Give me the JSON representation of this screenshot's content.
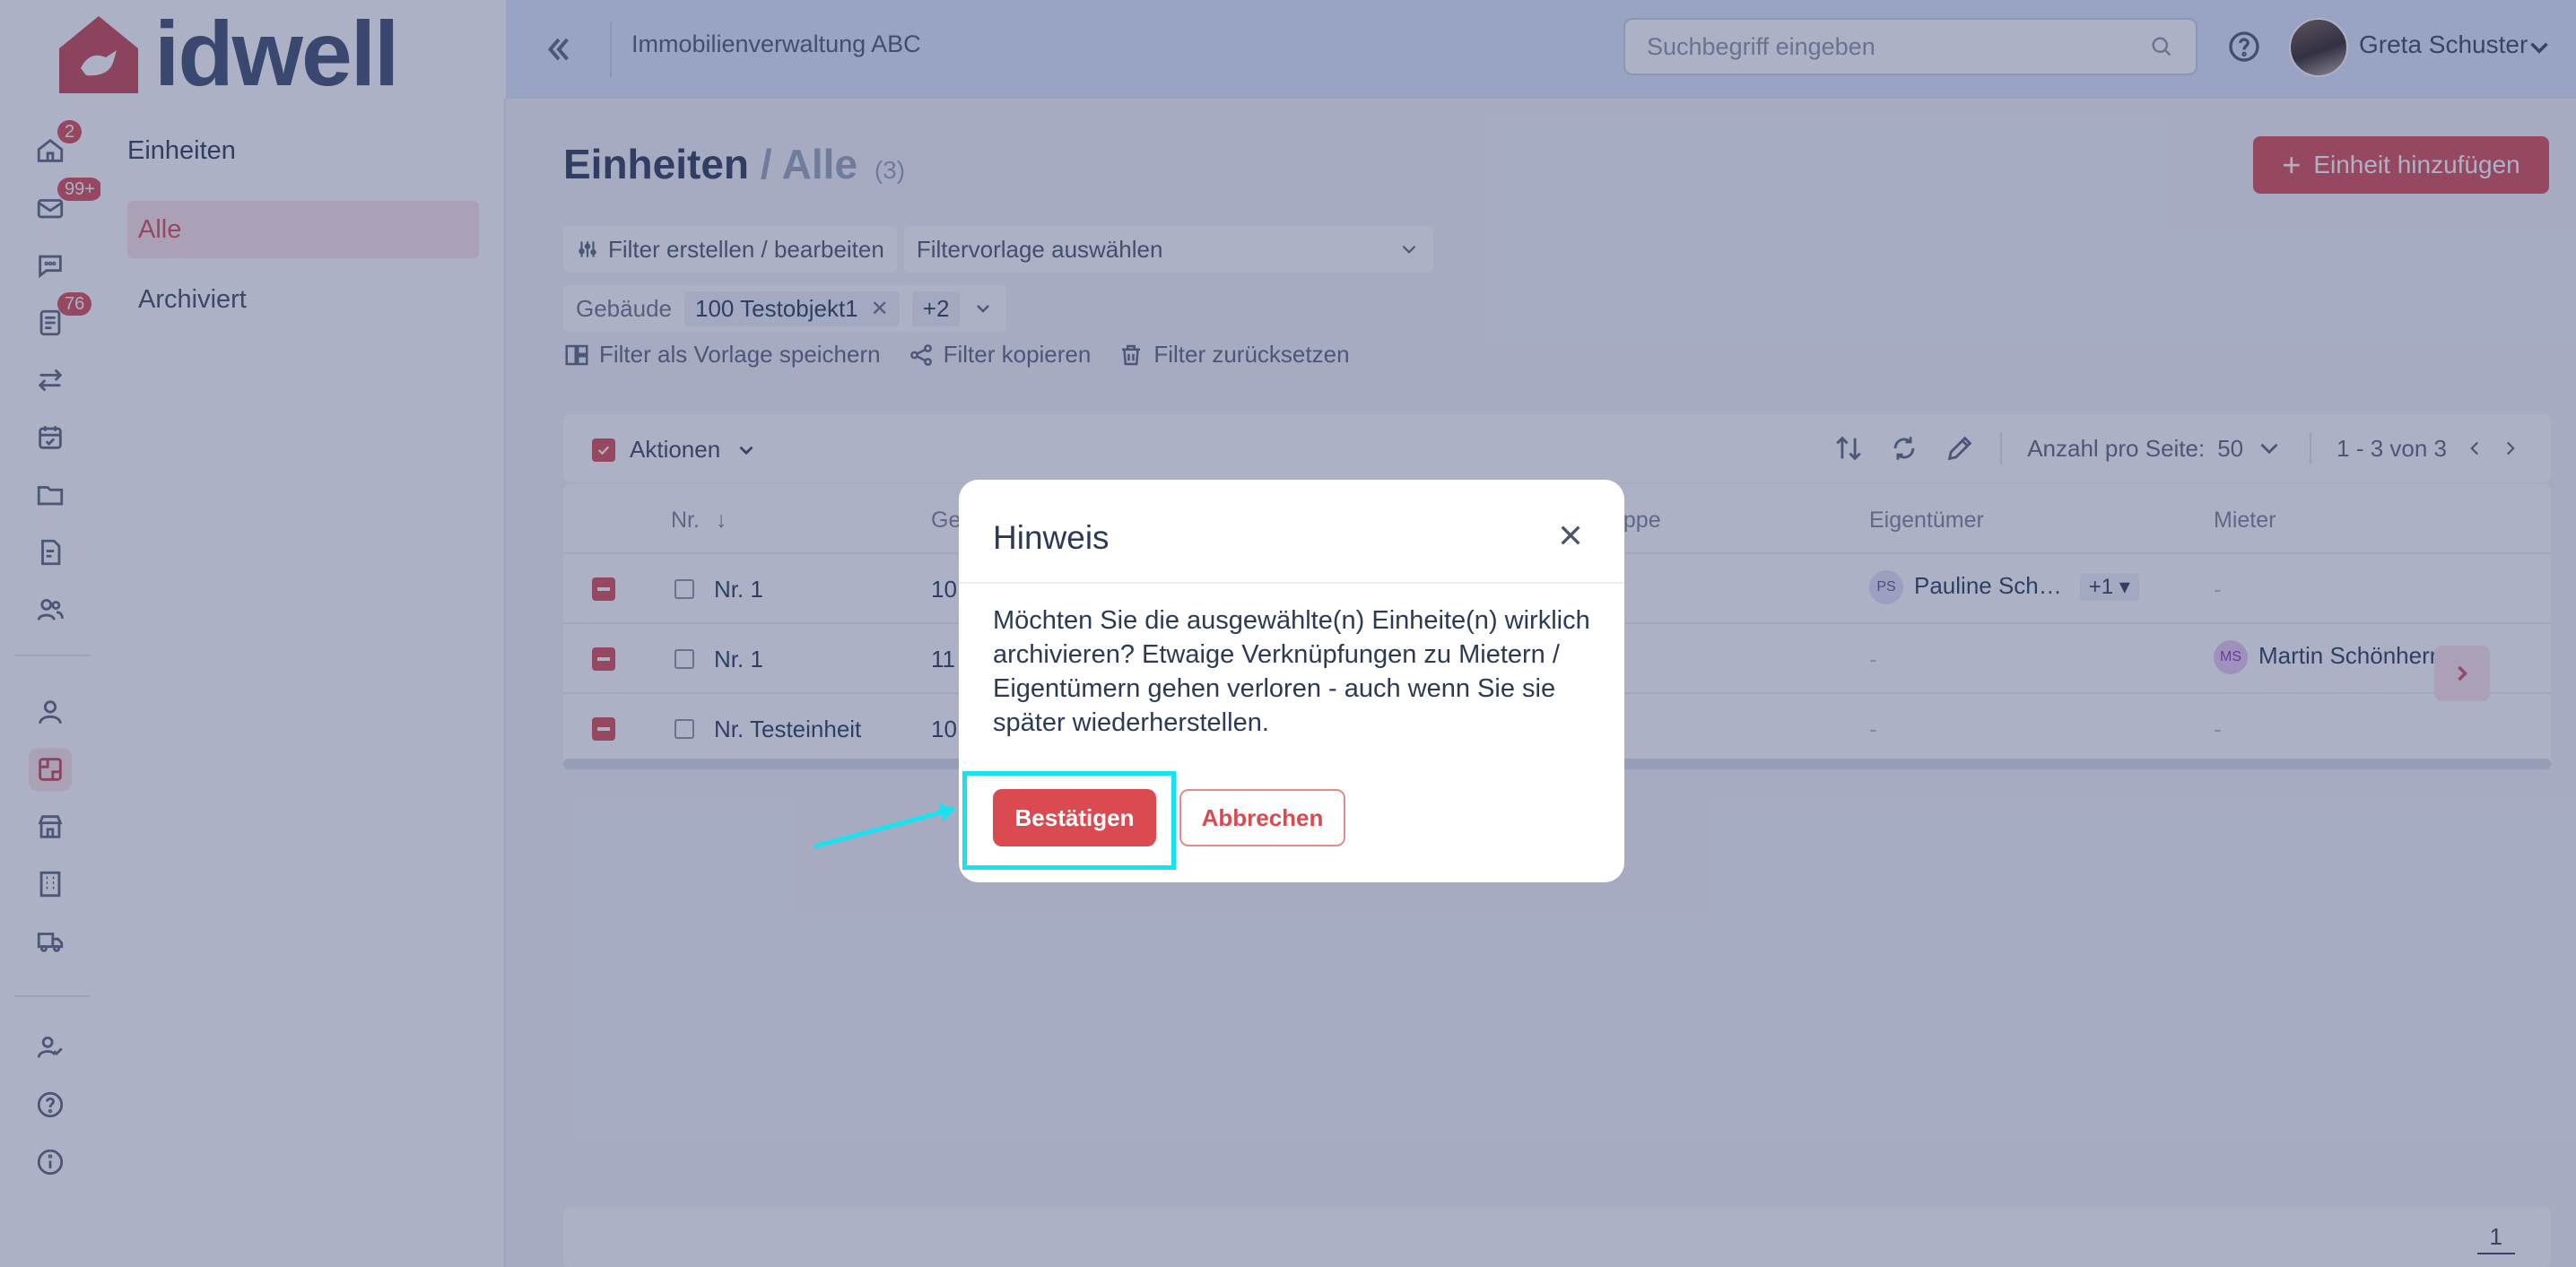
{
  "app": {
    "brand": "idwell",
    "company": "Immobilienverwaltung ABC"
  },
  "search": {
    "placeholder": "Suchbegriff eingeben"
  },
  "user": {
    "name": "Greta Schuster"
  },
  "rail": {
    "badges": {
      "home": "2",
      "mail": "99+",
      "documents": "76"
    }
  },
  "subsidebar": {
    "heading": "Einheiten",
    "items": [
      {
        "label": "Alle",
        "active": true
      },
      {
        "label": "Archiviert",
        "active": false
      }
    ]
  },
  "page": {
    "title": "Einheiten",
    "separator": "/",
    "subtitle": "Alle",
    "count": "(3)",
    "add_button": "Einheit hinzufügen"
  },
  "filters": {
    "edit_button": "Filter erstellen / bearbeiten",
    "template_select": "Filtervorlage auswählen",
    "building_label": "Gebäude",
    "building_tag": "100 Testobjekt1",
    "more_tag": "+2",
    "save_template": "Filter als Vorlage speichern",
    "copy": "Filter kopieren",
    "reset": "Filter zurücksetzen"
  },
  "toolbar": {
    "actions": "Aktionen",
    "per_page_label": "Anzahl pro Seite:",
    "per_page_value": "50",
    "range": "1 - 3 von 3"
  },
  "table": {
    "columns": [
      "Nr.",
      "Ge",
      "uppe",
      "Eigentümer",
      "Mieter"
    ],
    "rows": [
      {
        "nr": "Nr. 1",
        "ge": "10",
        "owner_initials": "PS",
        "owner": "Pauline Sch…",
        "owner_more": "+1 ▾",
        "tenant": "-"
      },
      {
        "nr": "Nr. 1",
        "ge": "11",
        "owner_initials": "",
        "owner": "-",
        "owner_more": "",
        "tenant_initials": "MS",
        "tenant": "Martin Schönherr"
      },
      {
        "nr": "Nr. Testeinheit",
        "ge": "10",
        "owner_initials": "",
        "owner": "-",
        "owner_more": "",
        "tenant": "-"
      }
    ]
  },
  "pagination": {
    "page": "1"
  },
  "modal": {
    "title": "Hinweis",
    "body": "Möchten Sie die ausgewählte(n) Einheite(n) wirklich archivieren? Etwaige Verknüpfungen zu Mietern / Eigentümern gehen verloren - auch wenn Sie sie später wiederherstellen.",
    "confirm": "Bestätigen",
    "cancel": "Abbrechen"
  },
  "colors": {
    "accent": "#d94b50",
    "highlight": "#17e3f0",
    "header_bg": "#dfe7fb"
  }
}
